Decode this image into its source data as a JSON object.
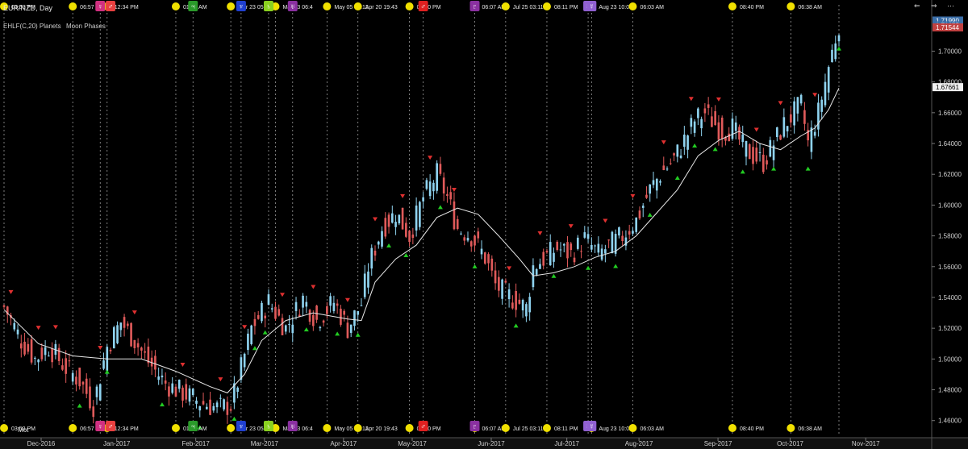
{
  "header": {
    "symbol": "EUR/NZD",
    "timeframe": "Day",
    "indicators": [
      {
        "label": "EHLF(C,20) Planets"
      },
      {
        "label": "Moon Phases"
      }
    ],
    "bottom_label": "Mot"
  },
  "colors": {
    "background": "#000000",
    "bull": "#8fd3f0",
    "bear": "#e05a5a",
    "ma_line": "#e8e8e8",
    "up_marker": "#22cc22",
    "down_marker": "#e03030",
    "moon": "#f0e000",
    "grid": "#3a3a3a",
    "price_tag": "#3a6ea8"
  },
  "chart_data": {
    "type": "candlestick",
    "title": "EUR/NZD, Day",
    "ylim": [
      1.452,
      1.728
    ],
    "y_ticks": [
      "1.46000",
      "1.48000",
      "1.50000",
      "1.52000",
      "1.54000",
      "1.56000",
      "1.58000",
      "1.60000",
      "1.62000",
      "1.64000",
      "1.66000",
      "1.68000",
      "1.70000"
    ],
    "x_month_labels": [
      {
        "label": "Dec-2016",
        "day": 0
      },
      {
        "label": "Jan-2017",
        "day": 22
      },
      {
        "label": "Feb-2017",
        "day": 45
      },
      {
        "label": "Mar-2017",
        "day": 65
      },
      {
        "label": "Apr-2017",
        "day": 88
      },
      {
        "label": "May-2017",
        "day": 108
      },
      {
        "label": "Jun-2017",
        "day": 131
      },
      {
        "label": "Jul-2017",
        "day": 153
      },
      {
        "label": "Aug-2017",
        "day": 174
      },
      {
        "label": "Sep-2017",
        "day": 197
      },
      {
        "label": "Oct-2017",
        "day": 218
      },
      {
        "label": "Nov-2017",
        "day": 240
      }
    ],
    "price_tags": [
      {
        "label": "1.71990",
        "value": 1.7199,
        "color": "#3a6ea8"
      },
      {
        "label": "1.71675",
        "value": 1.71675,
        "color": "#3a6ea8"
      },
      {
        "label": "1.71544",
        "value": 1.71544,
        "color": "#c04040"
      },
      {
        "label": "1.67661",
        "value": 1.67661,
        "color": "#3a6ea8"
      }
    ],
    "price_path": [
      [
        0,
        1.534
      ],
      [
        5,
        1.512
      ],
      [
        9,
        1.5
      ],
      [
        13,
        1.508
      ],
      [
        18,
        1.494
      ],
      [
        22,
        1.486
      ],
      [
        26,
        1.47
      ],
      [
        30,
        1.508
      ],
      [
        34,
        1.524
      ],
      [
        38,
        1.512
      ],
      [
        42,
        1.498
      ],
      [
        47,
        1.484
      ],
      [
        52,
        1.478
      ],
      [
        57,
        1.472
      ],
      [
        62,
        1.468
      ],
      [
        66,
        1.47
      ],
      [
        68,
        1.485
      ],
      [
        72,
        1.52
      ],
      [
        77,
        1.537
      ],
      [
        82,
        1.52
      ],
      [
        87,
        1.539
      ],
      [
        91,
        1.525
      ],
      [
        96,
        1.537
      ],
      [
        100,
        1.52
      ],
      [
        104,
        1.536
      ],
      [
        106,
        1.56
      ],
      [
        110,
        1.585
      ],
      [
        114,
        1.595
      ],
      [
        118,
        1.58
      ],
      [
        122,
        1.605
      ],
      [
        126,
        1.62
      ],
      [
        129,
        1.605
      ],
      [
        132,
        1.585
      ],
      [
        136,
        1.58
      ],
      [
        140,
        1.566
      ],
      [
        143,
        1.548
      ],
      [
        146,
        1.542
      ],
      [
        149,
        1.538
      ],
      [
        152,
        1.533
      ],
      [
        154,
        1.56
      ],
      [
        157,
        1.565
      ],
      [
        161,
        1.572
      ],
      [
        165,
        1.568
      ],
      [
        169,
        1.578
      ],
      [
        173,
        1.568
      ],
      [
        177,
        1.575
      ],
      [
        180,
        1.58
      ],
      [
        184,
        1.59
      ],
      [
        188,
        1.61
      ],
      [
        191,
        1.62
      ],
      [
        195,
        1.63
      ],
      [
        198,
        1.642
      ],
      [
        201,
        1.655
      ],
      [
        204,
        1.66
      ],
      [
        206,
        1.655
      ],
      [
        209,
        1.648
      ],
      [
        212,
        1.65
      ],
      [
        215,
        1.638
      ],
      [
        218,
        1.632
      ],
      [
        221,
        1.628
      ],
      [
        224,
        1.64
      ],
      [
        227,
        1.652
      ],
      [
        230,
        1.66
      ],
      [
        232,
        1.665
      ],
      [
        234,
        1.64
      ],
      [
        237,
        1.66
      ],
      [
        240,
        1.69
      ],
      [
        243,
        1.718
      ]
    ],
    "ma_path": [
      [
        0,
        1.532
      ],
      [
        10,
        1.51
      ],
      [
        20,
        1.502
      ],
      [
        30,
        1.5
      ],
      [
        40,
        1.5
      ],
      [
        50,
        1.492
      ],
      [
        60,
        1.482
      ],
      [
        65,
        1.478
      ],
      [
        70,
        1.49
      ],
      [
        75,
        1.512
      ],
      [
        82,
        1.525
      ],
      [
        90,
        1.53
      ],
      [
        100,
        1.526
      ],
      [
        104,
        1.525
      ],
      [
        108,
        1.55
      ],
      [
        114,
        1.565
      ],
      [
        120,
        1.574
      ],
      [
        126,
        1.592
      ],
      [
        132,
        1.598
      ],
      [
        138,
        1.594
      ],
      [
        144,
        1.58
      ],
      [
        150,
        1.565
      ],
      [
        154,
        1.554
      ],
      [
        160,
        1.556
      ],
      [
        166,
        1.56
      ],
      [
        172,
        1.566
      ],
      [
        178,
        1.57
      ],
      [
        184,
        1.58
      ],
      [
        190,
        1.595
      ],
      [
        196,
        1.61
      ],
      [
        202,
        1.632
      ],
      [
        208,
        1.642
      ],
      [
        214,
        1.648
      ],
      [
        220,
        1.64
      ],
      [
        226,
        1.636
      ],
      [
        232,
        1.645
      ],
      [
        236,
        1.65
      ],
      [
        240,
        1.662
      ],
      [
        243,
        1.676
      ]
    ],
    "up_markers": [
      22,
      30,
      46,
      57,
      67,
      73,
      76,
      88,
      97,
      103,
      112,
      117,
      127,
      137,
      149,
      160,
      170,
      178,
      188,
      196,
      201,
      207,
      215,
      224,
      234,
      243
    ],
    "down_markers": [
      2,
      10,
      15,
      28,
      38,
      52,
      63,
      70,
      81,
      90,
      100,
      108,
      116,
      124,
      131,
      147,
      156,
      165,
      175,
      183,
      192,
      200,
      208,
      219,
      226,
      236
    ],
    "moon_events": [
      {
        "label": "03:53 PM",
        "day": 0
      },
      {
        "label": "06:57 PM",
        "day": 20
      },
      {
        "label": "12:34 PM",
        "day": 30
      },
      {
        "label": "01:33 AM",
        "day": 50
      },
      {
        "label": "Mar 23 05:4",
        "day": 66
      },
      {
        "label": "Mar 23 06:4",
        "day": 79
      },
      {
        "label": "May 05 09:12",
        "day": 94
      },
      {
        "label": "Apr 20 19:43",
        "day": 103
      },
      {
        "label": "03:10 PM",
        "day": 118
      },
      {
        "label": "06:07 AM",
        "day": 137
      },
      {
        "label": "Jul 25 03:11",
        "day": 146
      },
      {
        "label": "08:11 PM",
        "day": 158
      },
      {
        "label": "Aug 23 10:03",
        "day": 171
      },
      {
        "label": "06:03 AM",
        "day": 183
      },
      {
        "label": "08:40 PM",
        "day": 212
      },
      {
        "label": "06:38 AM",
        "day": 229
      }
    ],
    "planet_events": [
      {
        "day": 28,
        "color": "#d03080",
        "glyph": "♀"
      },
      {
        "day": 31,
        "color": "#e84040",
        "glyph": "♂"
      },
      {
        "day": 55,
        "color": "#2a9a2a",
        "glyph": "♃"
      },
      {
        "day": 69,
        "color": "#2040d0",
        "glyph": "♆"
      },
      {
        "day": 77,
        "color": "#8ad020",
        "glyph": "♄"
      },
      {
        "day": 84,
        "color": "#8a30a0",
        "glyph": "♅"
      },
      {
        "day": 122,
        "color": "#e02020",
        "glyph": "♂"
      },
      {
        "day": 137,
        "color": "#8a30a0",
        "glyph": "♇"
      },
      {
        "day": 170,
        "color": "#9060d0",
        "glyph": "♅"
      },
      {
        "day": 171,
        "color": "#9060d0",
        "glyph": "☿"
      }
    ],
    "dotted_line_days": [
      0,
      20,
      28,
      30,
      50,
      55,
      66,
      69,
      77,
      79,
      84,
      94,
      103,
      118,
      122,
      137,
      146,
      158,
      170,
      171,
      183,
      212,
      229,
      243
    ]
  }
}
